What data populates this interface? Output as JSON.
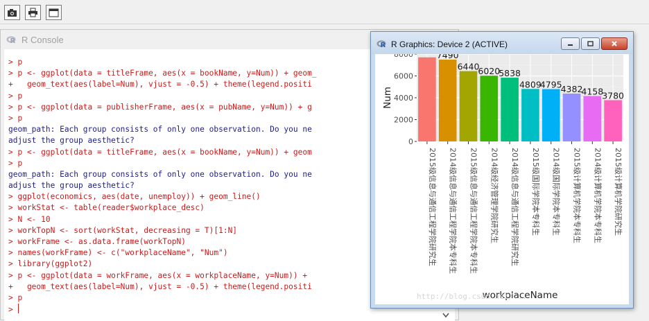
{
  "toolbar": {
    "buttons": [
      {
        "name": "camera-icon"
      },
      {
        "name": "print-icon"
      },
      {
        "name": "window-icon"
      }
    ]
  },
  "console": {
    "title": "R Console",
    "lines": [
      {
        "kind": "cmd",
        "text": "> p"
      },
      {
        "kind": "cmd",
        "text": "> p <- ggplot(data = titleFrame, aes(x = bookName, y=Num)) + geom_"
      },
      {
        "kind": "cmd",
        "text": "+   geom_text(aes(label=Num), vjust = -0.5) + theme(legend.positi"
      },
      {
        "kind": "cmd",
        "text": "> p"
      },
      {
        "kind": "cmd",
        "text": "> p <- ggplot(data = publisherFrame, aes(x = pubName, y=Num)) + g"
      },
      {
        "kind": "cmd",
        "text": "> p"
      },
      {
        "kind": "out",
        "text": "geom_path: Each group consists of only one observation. Do you ne"
      },
      {
        "kind": "out",
        "text": "adjust the group aesthetic?"
      },
      {
        "kind": "cmd",
        "text": "> p <- ggplot(data = titleFrame, aes(x = bookName, y=Num)) + geom"
      },
      {
        "kind": "cmd",
        "text": "> p"
      },
      {
        "kind": "out",
        "text": "geom_path: Each group consists of only one observation. Do you ne"
      },
      {
        "kind": "out",
        "text": "adjust the group aesthetic?"
      },
      {
        "kind": "cmd",
        "text": "> ggplot(economics, aes(date, unemploy)) + geom_line()"
      },
      {
        "kind": "cmd",
        "text": "> workStat <- table(reader$workplace_desc)"
      },
      {
        "kind": "cmd",
        "text": "> N <- 10"
      },
      {
        "kind": "cmd",
        "text": "> workTopN <- sort(workStat, decreasing = T)[1:N]"
      },
      {
        "kind": "cmd",
        "text": "> workFrame <- as.data.frame(workTopN)"
      },
      {
        "kind": "cmd",
        "text": "> names(workFrame) <- c(\"workplaceName\", \"Num\")"
      },
      {
        "kind": "cmd",
        "text": "> library(ggplot2)"
      },
      {
        "kind": "cmd",
        "text": "> p <- ggplot(data = workFrame, aes(x = workplaceName, y=Num)) + "
      },
      {
        "kind": "cmd",
        "text": "+   geom_text(aes(label=Num), vjust = -0.5) + theme(legend.positi"
      },
      {
        "kind": "cmd",
        "text": "> p"
      },
      {
        "kind": "prompt",
        "text": "> "
      }
    ]
  },
  "graphics": {
    "title": "R Graphics: Device 2 (ACTIVE)",
    "watermark": "http://blog.csdn.net/...",
    "colors": {
      "panel": "#ebebeb",
      "grid": "#ffffff",
      "minor_grid": "#f3f3f3"
    }
  },
  "chart_data": {
    "type": "bar",
    "categories": [
      "2015级信息与通信工程学院研究生",
      "2014级信息与通信工程学院本专科生",
      "2015级信息与通信工程学院本专科生",
      "2014级经济管理学院研究生",
      "2014级信息与通信工程学院研究生",
      "2015级国际学院本专科生",
      "2014级国际学院本专科生",
      "2015级计算机学院本专科生",
      "2014级计算机学院本专科生",
      "2015级计算机学院研究生"
    ],
    "values": [
      7700,
      7490,
      6440,
      6020,
      5838,
      4809,
      4795,
      4382,
      4158,
      3780
    ],
    "labels": [
      "",
      "7490",
      "6440",
      "6020",
      "5838",
      "4809",
      "4795",
      "4382",
      "4158",
      "3780"
    ],
    "colors": [
      "#f8766d",
      "#d89000",
      "#a3a500",
      "#39b600",
      "#00bf7d",
      "#00bfc4",
      "#00b0f6",
      "#9590ff",
      "#e76bf3",
      "#ff62bc"
    ],
    "xlabel": "workplaceName",
    "ylabel": "Num",
    "yticks": [
      "0",
      "2000",
      "4000",
      "6000",
      "8000"
    ],
    "ylim": [
      0,
      8000
    ],
    "grid": true,
    "legend": "none"
  }
}
